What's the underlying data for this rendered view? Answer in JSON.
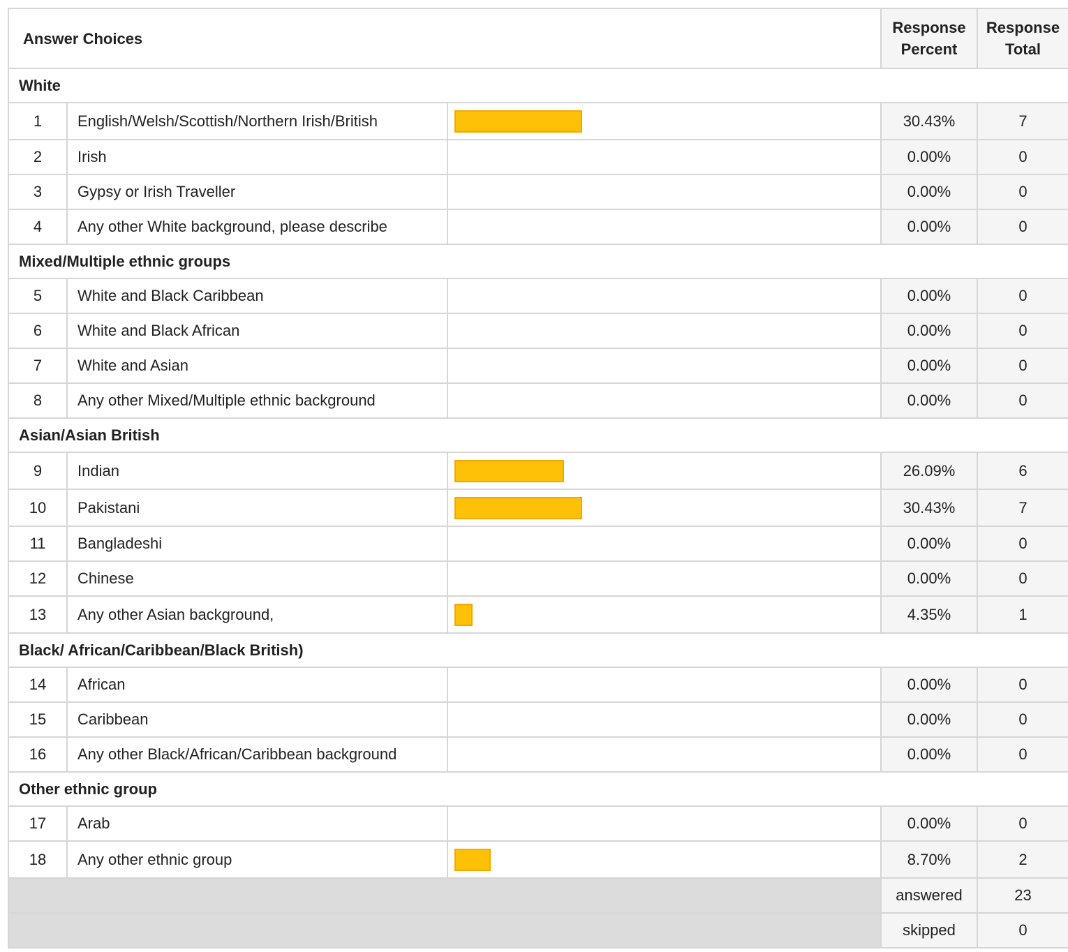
{
  "header": {
    "answer_choices": "Answer Choices",
    "response_percent_line1": "Response",
    "response_percent_line2": "Percent",
    "response_total_line1": "Response",
    "response_total_line2": "Total"
  },
  "bar_color": "#ffc107",
  "groups": [
    {
      "title": "White",
      "rows": [
        {
          "num": "1",
          "label": "English/Welsh/Scottish/Northern Irish/British",
          "percent": "30.43%",
          "total": "7",
          "fraction": 0.3043
        },
        {
          "num": "2",
          "label": "Irish",
          "percent": "0.00%",
          "total": "0",
          "fraction": 0
        },
        {
          "num": "3",
          "label": "Gypsy or Irish Traveller",
          "percent": "0.00%",
          "total": "0",
          "fraction": 0
        },
        {
          "num": "4",
          "label": "Any other White background, please describe",
          "percent": "0.00%",
          "total": "0",
          "fraction": 0
        }
      ]
    },
    {
      "title": "Mixed/Multiple ethnic groups",
      "rows": [
        {
          "num": "5",
          "label": "White and Black Caribbean",
          "percent": "0.00%",
          "total": "0",
          "fraction": 0
        },
        {
          "num": "6",
          "label": "White and Black African",
          "percent": "0.00%",
          "total": "0",
          "fraction": 0
        },
        {
          "num": "7",
          "label": "White and Asian",
          "percent": "0.00%",
          "total": "0",
          "fraction": 0
        },
        {
          "num": "8",
          "label": "Any other Mixed/Multiple ethnic background",
          "percent": "0.00%",
          "total": "0",
          "fraction": 0
        }
      ]
    },
    {
      "title": "Asian/Asian British",
      "rows": [
        {
          "num": "9",
          "label": "Indian",
          "percent": "26.09%",
          "total": "6",
          "fraction": 0.2609
        },
        {
          "num": "10",
          "label": "Pakistani",
          "percent": "30.43%",
          "total": "7",
          "fraction": 0.3043
        },
        {
          "num": "11",
          "label": "Bangladeshi",
          "percent": "0.00%",
          "total": "0",
          "fraction": 0
        },
        {
          "num": "12",
          "label": "Chinese",
          "percent": "0.00%",
          "total": "0",
          "fraction": 0
        },
        {
          "num": "13",
          "label": "Any other Asian background,",
          "percent": "4.35%",
          "total": "1",
          "fraction": 0.0435
        }
      ]
    },
    {
      "title": "Black/ African/Caribbean/Black British)",
      "rows": [
        {
          "num": "14",
          "label": "African",
          "percent": "0.00%",
          "total": "0",
          "fraction": 0
        },
        {
          "num": "15",
          "label": "Caribbean",
          "percent": "0.00%",
          "total": "0",
          "fraction": 0
        },
        {
          "num": "16",
          "label": "Any other Black/African/Caribbean background",
          "percent": "0.00%",
          "total": "0",
          "fraction": 0
        }
      ]
    },
    {
      "title": "Other ethnic group",
      "rows": [
        {
          "num": "17",
          "label": "Arab",
          "percent": "0.00%",
          "total": "0",
          "fraction": 0
        },
        {
          "num": "18",
          "label": "Any other ethnic group",
          "percent": "8.70%",
          "total": "2",
          "fraction": 0.087
        }
      ]
    }
  ],
  "footer": {
    "answered_label": "answered",
    "answered_value": "23",
    "skipped_label": "skipped",
    "skipped_value": "0"
  }
}
